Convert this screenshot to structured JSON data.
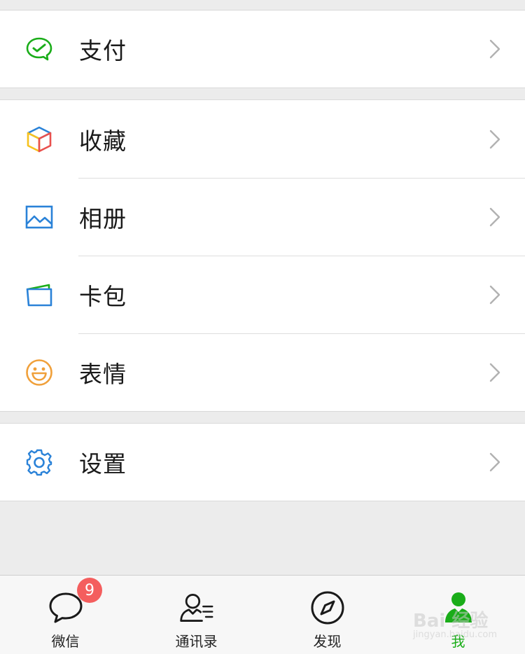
{
  "menu": {
    "groups": [
      {
        "items": [
          {
            "label": "支付",
            "icon": "wechat-pay-icon"
          }
        ]
      },
      {
        "items": [
          {
            "label": "收藏",
            "icon": "favorites-cube-icon"
          },
          {
            "label": "相册",
            "icon": "album-picture-icon"
          },
          {
            "label": "卡包",
            "icon": "card-wallet-icon"
          },
          {
            "label": "表情",
            "icon": "smiley-face-icon"
          }
        ]
      },
      {
        "items": [
          {
            "label": "设置",
            "icon": "gear-icon"
          }
        ]
      }
    ]
  },
  "tabbar": {
    "tabs": [
      {
        "label": "微信",
        "icon": "chat-bubble-icon",
        "badge": "9",
        "active": false
      },
      {
        "label": "通讯录",
        "icon": "contacts-icon",
        "active": false
      },
      {
        "label": "发现",
        "icon": "compass-icon",
        "active": false
      },
      {
        "label": "我",
        "icon": "me-person-icon",
        "active": true
      }
    ]
  },
  "watermark": {
    "text": "Bai 经验",
    "sub": "jingyan.baidu.com"
  },
  "colors": {
    "active": "#1aad19",
    "badge": "#f45e5e",
    "background": "#ececec",
    "pay": "#1aad19",
    "album": "#2a82d8",
    "card": "#2a82d8",
    "smiley": "#f0a03a",
    "gear": "#2a82d8"
  }
}
